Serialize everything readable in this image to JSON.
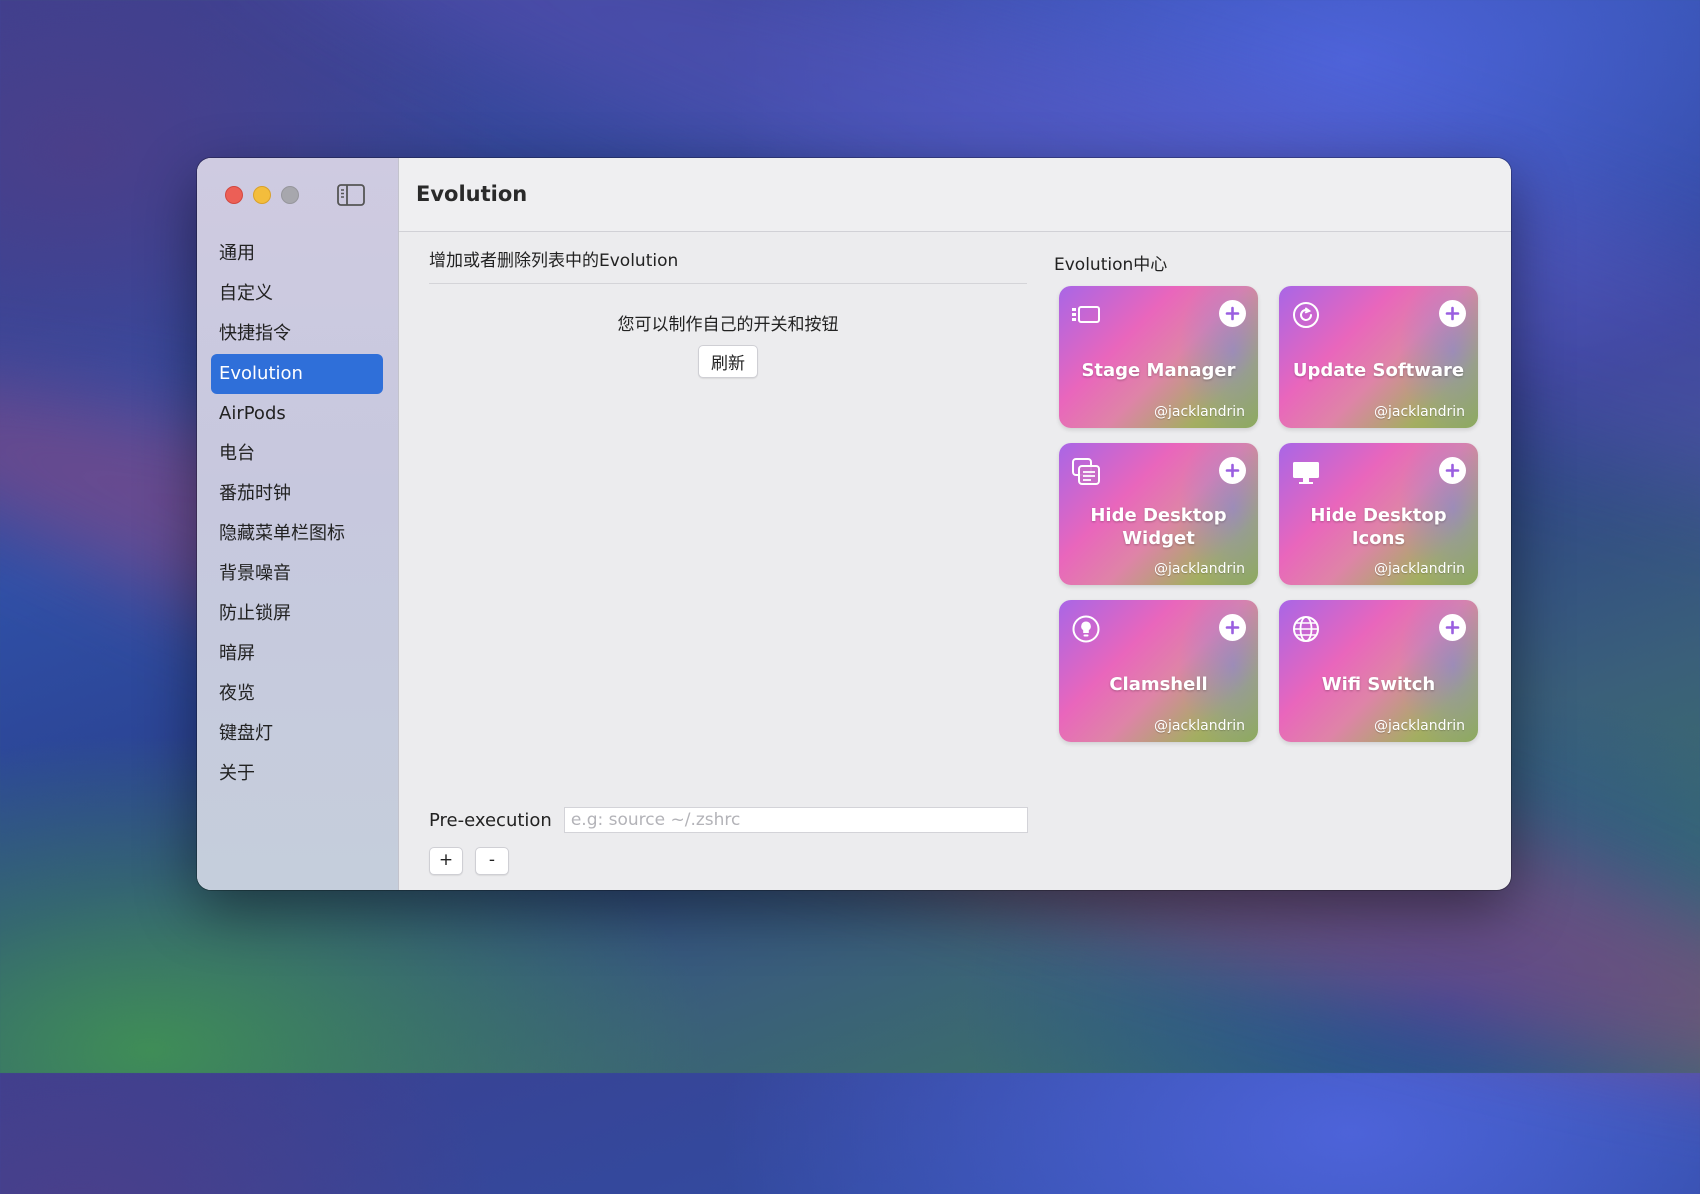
{
  "window": {
    "title": "Evolution"
  },
  "sidebar": {
    "items": [
      {
        "label": "通用"
      },
      {
        "label": "自定义"
      },
      {
        "label": "快捷指令"
      },
      {
        "label": "Evolution",
        "active": true
      },
      {
        "label": "AirPods"
      },
      {
        "label": "电台"
      },
      {
        "label": "番茄时钟"
      },
      {
        "label": "隐藏菜单栏图标"
      },
      {
        "label": "背景噪音"
      },
      {
        "label": "防止锁屏"
      },
      {
        "label": "暗屏"
      },
      {
        "label": "夜览"
      },
      {
        "label": "键盘灯"
      },
      {
        "label": "关于"
      }
    ]
  },
  "left": {
    "heading": "增加或者删除列表中的Evolution",
    "hint": "您可以制作自己的开关和按钮",
    "refresh_label": "刷新"
  },
  "pre_execution": {
    "label": "Pre-execution",
    "placeholder": "e.g: source ~/.zshrc",
    "value": "",
    "add_label": "+",
    "remove_label": "-"
  },
  "center": {
    "title": "Evolution中心",
    "cards": [
      {
        "title": "Stage Manager",
        "author": "@jacklandrin",
        "icon": "stage-manager-icon"
      },
      {
        "title": "Update Software",
        "author": "@jacklandrin",
        "icon": "refresh-gear-icon"
      },
      {
        "title": "Hide Desktop Widget",
        "author": "@jacklandrin",
        "icon": "widgets-icon"
      },
      {
        "title": "Hide Desktop Icons",
        "author": "@jacklandrin",
        "icon": "desktop-icon"
      },
      {
        "title": "Clamshell",
        "author": "@jacklandrin",
        "icon": "lightbulb-icon"
      },
      {
        "title": "Wifi Switch",
        "author": "@jacklandrin",
        "icon": "globe-icon"
      }
    ]
  },
  "colors": {
    "accent": "#2f6fd9",
    "close": "#ec5f56",
    "minimize": "#f3bd3c",
    "zoom_disabled": "#a7a7ad"
  }
}
